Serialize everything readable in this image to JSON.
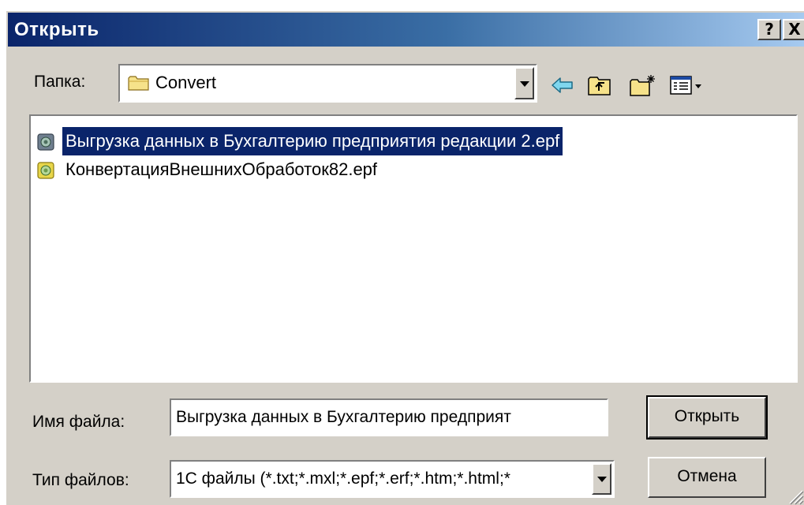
{
  "window": {
    "title": "Открыть",
    "help_button": "?",
    "close_button": "X"
  },
  "folder": {
    "label": "Папка:",
    "current": "Convert"
  },
  "files": [
    {
      "name": "Выгрузка данных в Бухгалтерию предприятия редакции 2.epf",
      "selected": true
    },
    {
      "name": "КонвертацияВнешнихОбработок82.epf",
      "selected": false
    }
  ],
  "filename": {
    "label": "Имя файла:",
    "value": "Выгрузка данных в Бухгалтерию предприят"
  },
  "filetype": {
    "label": "Тип файлов:",
    "value": "1С файлы (*.txt;*.mxl;*.epf;*.erf;*.htm;*.html;*"
  },
  "buttons": {
    "open": "Открыть",
    "cancel": "Отмена"
  },
  "colors": {
    "titlebar_start": "#0a246a",
    "titlebar_end": "#a6caf0",
    "selection": "#0a246a",
    "face": "#d4d0c8"
  },
  "icons": [
    "folder-icon",
    "back-arrow-icon",
    "up-folder-icon",
    "new-folder-icon",
    "view-menu-icon",
    "epf-file-icon",
    "chevron-down-icon"
  ]
}
